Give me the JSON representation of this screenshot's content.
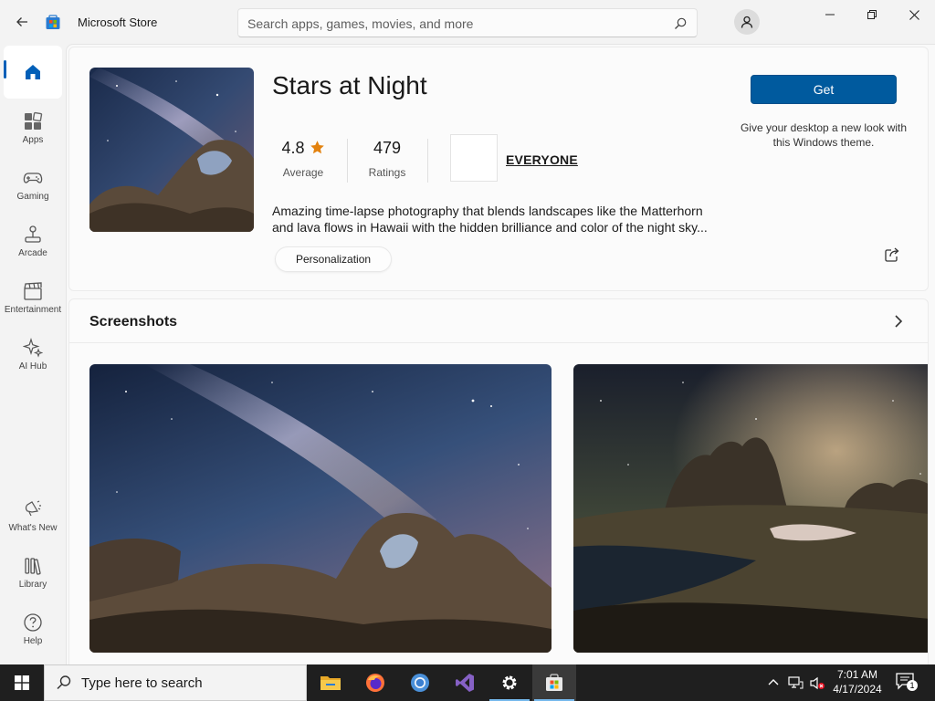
{
  "window": {
    "app_title": "Microsoft Store",
    "search_placeholder": "Search apps, games, movies, and more"
  },
  "sidebar": {
    "items": [
      {
        "label": "",
        "icon": "home-icon",
        "active": true
      },
      {
        "label": "Apps",
        "icon": "apps-icon"
      },
      {
        "label": "Gaming",
        "icon": "gamepad-icon"
      },
      {
        "label": "Arcade",
        "icon": "joystick-icon"
      },
      {
        "label": "Entertainment",
        "icon": "clapperboard-icon"
      },
      {
        "label": "AI Hub",
        "icon": "sparkle-icon"
      },
      {
        "label": "What's New",
        "icon": "megaphone-icon"
      },
      {
        "label": "Library",
        "icon": "library-icon"
      },
      {
        "label": "Help",
        "icon": "help-icon"
      }
    ]
  },
  "product": {
    "title": "Stars at Night",
    "rating_value": "4.8",
    "rating_label": "Average",
    "ratings_count": "479",
    "ratings_label": "Ratings",
    "age_rating": "EVERYONE",
    "description": "Amazing time-lapse photography that blends landscapes like the Matterhorn and lava flows in Hawaii with the hidden brilliance and color of the night sky...",
    "tag": "Personalization",
    "get_label": "Get",
    "get_subtext": "Give your desktop a new look with this Windows theme."
  },
  "screenshots": {
    "title": "Screenshots"
  },
  "taskbar": {
    "search_placeholder": "Type here to search",
    "apps": [
      "file-explorer-icon",
      "firefox-icon",
      "chrome-icon",
      "visual-studio-icon",
      "settings-icon",
      "store-icon"
    ],
    "time": "7:01 AM",
    "date": "4/17/2024",
    "notification_count": "1"
  },
  "colors": {
    "accent": "#005a9e",
    "nav_indicator": "#005fb8",
    "star": "#e3820f"
  }
}
